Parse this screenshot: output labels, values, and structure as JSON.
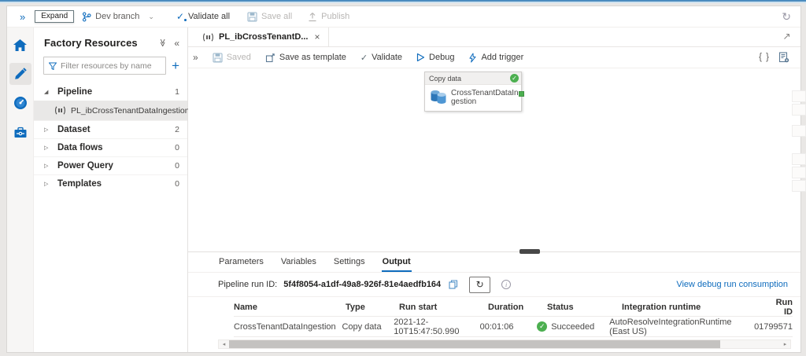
{
  "colors": {
    "accent_blue": "#0f6cbd",
    "success_green": "#4caf50",
    "selected_row_bg": "#e9e8e7",
    "link_blue": "#0f6cbd"
  },
  "icons": {
    "expand_rail": "»",
    "toolbar_expand": "»",
    "collapse_all": "≫",
    "collapse_panel": "«",
    "chevron_down": "⌄",
    "plus": "+",
    "close": "×",
    "check": "✓",
    "braces": "{ }",
    "refresh": "↻",
    "info": "i",
    "scroll_left": "◂",
    "scroll_right": "▸",
    "expander_expanded": "◢",
    "expander_collapsed": "▷"
  },
  "topbar": {
    "expand_tooltip": "Expand",
    "branch_label": "Dev branch",
    "validate_all_label": "Validate all",
    "save_all_label": "Save all",
    "publish_label": "Publish"
  },
  "resources_panel": {
    "title": "Factory Resources",
    "filter_placeholder": "Filter resources by name",
    "tree": [
      {
        "label": "Pipeline",
        "count": "1",
        "children": [
          {
            "label": "PL_ibCrossTenantDataIngestion"
          }
        ]
      },
      {
        "label": "Dataset",
        "count": "2"
      },
      {
        "label": "Data flows",
        "count": "0"
      },
      {
        "label": "Power Query",
        "count": "0"
      },
      {
        "label": "Templates",
        "count": "0"
      }
    ]
  },
  "tab_bar": {
    "active_tab_label": "PL_ibCrossTenantD..."
  },
  "toolbar": {
    "saved_label": "Saved",
    "save_as_template_label": "Save as template",
    "validate_label": "Validate",
    "debug_label": "Debug",
    "add_trigger_label": "Add trigger"
  },
  "canvas": {
    "activity": {
      "type_label": "Copy data",
      "name": "CrossTenantDataIngestion"
    }
  },
  "bottom_panel": {
    "tabs": [
      {
        "label": "Parameters"
      },
      {
        "label": "Variables"
      },
      {
        "label": "Settings"
      },
      {
        "label": "Output"
      }
    ],
    "run_id_label": "Pipeline run ID:",
    "run_id_value": "5f4f8054-a1df-49a8-926f-81e4aedfb164",
    "view_link_label": "View debug run consumption",
    "table": {
      "columns": [
        "Name",
        "Type",
        "Run start",
        "Duration",
        "Status",
        "Integration runtime",
        "Run ID"
      ],
      "rows": [
        {
          "name": "CrossTenantDataIngestion",
          "type": "Copy data",
          "run_start": "2021-12-10T15:47:50.990",
          "duration": "00:01:06",
          "status": "Succeeded",
          "integration_runtime": "AutoResolveIntegrationRuntime (East US)",
          "run_id": "01799571"
        }
      ]
    }
  }
}
